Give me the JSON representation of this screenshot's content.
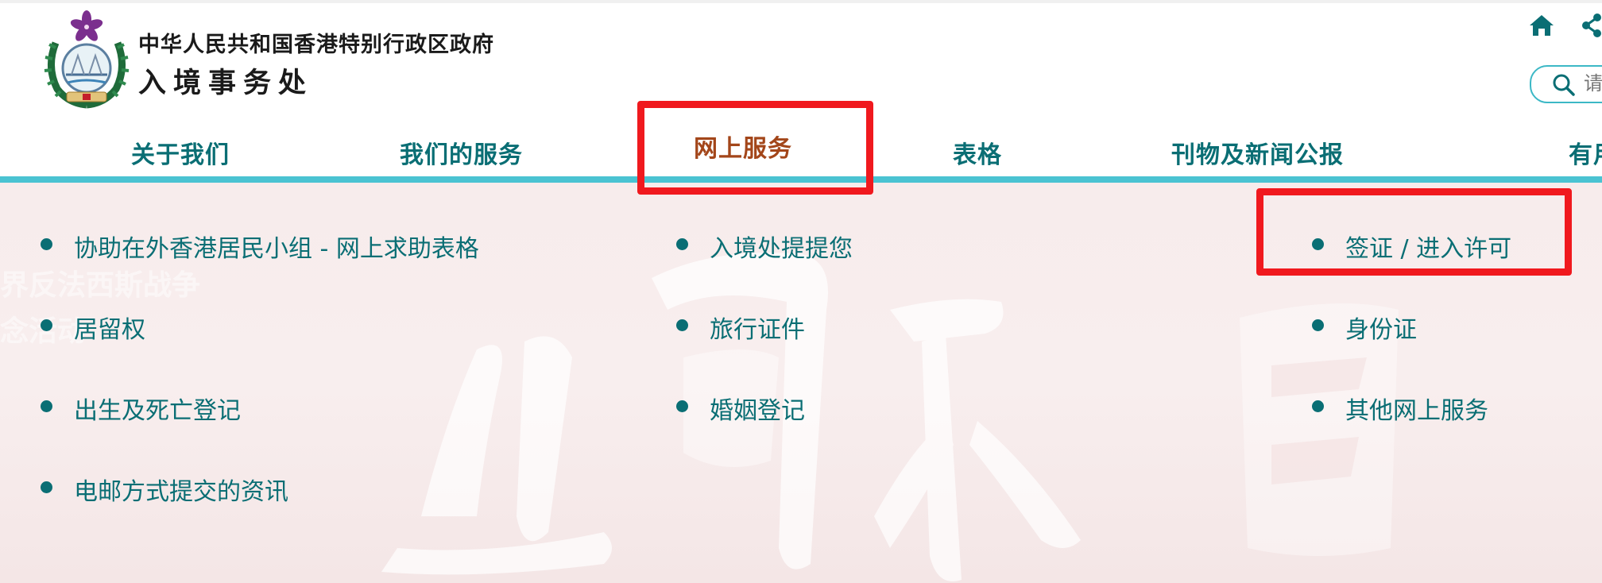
{
  "header": {
    "gov_title": "中华人民共和国香港特别行政区政府",
    "dept_title": "入境事务处",
    "search_placeholder": "请"
  },
  "nav": {
    "items": [
      {
        "label": "关于我们"
      },
      {
        "label": "我们的服务"
      },
      {
        "label": "网上服务",
        "active": true
      },
      {
        "label": "表格"
      },
      {
        "label": "刊物及新闻公报"
      },
      {
        "label": "有用"
      }
    ]
  },
  "dropdown": {
    "background_text": [
      "界反法西斯战争",
      "念活动"
    ],
    "column1": [
      "协助在外香港居民小组 - 网上求助表格",
      "居留权",
      "出生及死亡登记",
      "电邮方式提交的资讯"
    ],
    "column2": [
      "入境处提提您",
      "旅行证件",
      "婚姻登记"
    ],
    "column3": [
      "签证 / 进入许可",
      "身份证",
      "其他网上服务"
    ]
  },
  "colors": {
    "teal_text": "#0a6e74",
    "active_nav": "#a3461a",
    "nav_underline": "#4ac3d2",
    "highlight_box": "#f0191e",
    "logo_purple": "#7b2f8e",
    "logo_green": "#1f6b3a"
  },
  "icons": [
    "emblem-logo",
    "home-icon",
    "share-icon",
    "search-icon",
    "bullet-icon"
  ]
}
